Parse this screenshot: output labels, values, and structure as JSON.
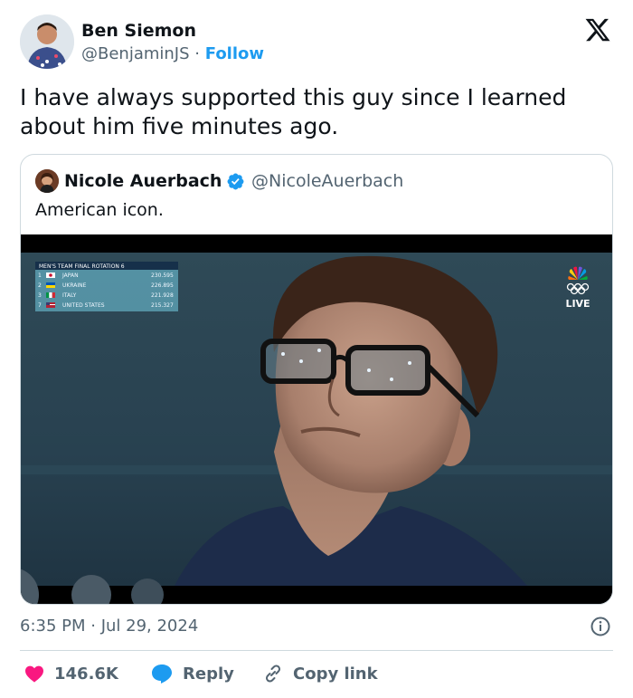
{
  "author": {
    "name": "Ben Siemon",
    "handle": "@BenjaminJS",
    "separator": "·",
    "follow_label": "Follow"
  },
  "tweet": {
    "text": "I have always supported this guy since I learned about him five minutes ago."
  },
  "quoted": {
    "name": "Nicole Auerbach",
    "handle": "@NicoleAuerbach",
    "text": "American icon."
  },
  "media": {
    "scoreboard": {
      "title": "MEN'S TEAM FINAL  ROTATION 6",
      "rows": [
        {
          "rank": "1",
          "country": "JAPAN",
          "score": "230.595"
        },
        {
          "rank": "2",
          "country": "UKRAINE",
          "score": "226.895"
        },
        {
          "rank": "3",
          "country": "ITALY",
          "score": "221.928"
        },
        {
          "rank": "7",
          "country": "UNITED STATES",
          "score": "215.327"
        }
      ]
    },
    "live_label": "LIVE"
  },
  "timestamp": "6:35 PM · Jul 29, 2024",
  "actions": {
    "likes": "146.6K",
    "reply_label": "Reply",
    "copy_label": "Copy link"
  },
  "colors": {
    "accent": "#1d9bf0",
    "like": "#f91880",
    "text": "#0f1419",
    "muted": "#536471",
    "border": "#cfd9de"
  }
}
